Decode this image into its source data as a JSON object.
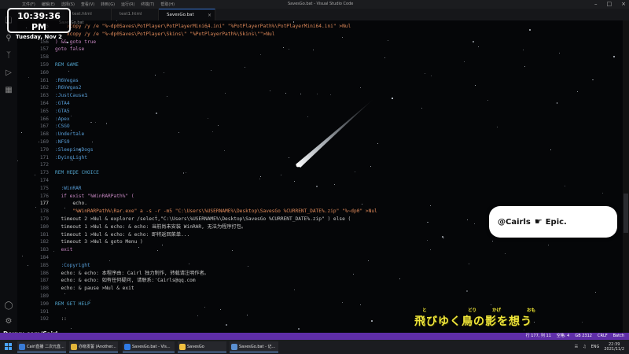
{
  "window": {
    "title": "SavesGo.bat - Visual Studio Code",
    "menu": [
      "文件(F)",
      "编辑(E)",
      "选择(S)",
      "查看(V)",
      "转到(G)",
      "运行(R)",
      "终端(T)",
      "帮助(H)"
    ]
  },
  "tabs": [
    {
      "label": "test.html",
      "active": false
    },
    {
      "label": "test1.html",
      "active": false
    },
    {
      "label": "SavesGo.bat",
      "active": true
    }
  ],
  "breadcrumb": "SavesGo.bat",
  "editor": {
    "lines": [
      {
        "n": "155",
        "code": "    xcopy /y /e \"%~dp0Saves\\PotPlayer\\PotPlayerMini64.ini\" \"%PotPlayerPath%\\PotPlayerMini64.ini\" >Nul",
        "cls": "str"
      },
      {
        "n": "",
        "code": "    xcopy /y /e \"%~dp0Saves\\PotPlayer\\Skins\\\" \"%PotPlayerPath%\\Skins\\\"\">Nul",
        "cls": "str"
      },
      {
        "n": "156",
        "code": ") && goto true",
        "cls": "kw"
      },
      {
        "n": "157",
        "code": "goto false",
        "cls": "kw"
      },
      {
        "n": "158",
        "code": "",
        "cls": ""
      },
      {
        "n": "159",
        "code": "REM GAME",
        "cls": "cm"
      },
      {
        "n": "160",
        "code": "",
        "cls": ""
      },
      {
        "n": "161",
        "code": ":R6Vegas",
        "cls": "lbl"
      },
      {
        "n": "162",
        "code": ":R6Vegas2",
        "cls": "lbl"
      },
      {
        "n": "163",
        "code": ":JustCause3",
        "cls": "lbl"
      },
      {
        "n": "164",
        "code": ":GTA4",
        "cls": "lbl"
      },
      {
        "n": "165",
        "code": ":GTA5",
        "cls": "lbl"
      },
      {
        "n": "166",
        "code": ":Apex",
        "cls": "lbl"
      },
      {
        "n": "167",
        "code": ":CSGO",
        "cls": "lbl"
      },
      {
        "n": "168",
        "code": ":Undertale",
        "cls": "lbl"
      },
      {
        "n": "169",
        "code": ":NFS9",
        "cls": "lbl"
      },
      {
        "n": "170",
        "code": ":SleepingDogs",
        "cls": "lbl"
      },
      {
        "n": "171",
        "code": ":DyingLight",
        "cls": "lbl"
      },
      {
        "n": "172",
        "code": "",
        "cls": ""
      },
      {
        "n": "173",
        "code": "REM HEDE CHOICE",
        "cls": "cm"
      },
      {
        "n": "174",
        "code": "",
        "cls": ""
      },
      {
        "n": "175",
        "code": "  :WinRAR",
        "cls": "lbl"
      },
      {
        "n": "176",
        "code": "  if exist \"%WinRARPath%\" (",
        "cls": "kw"
      },
      {
        "n": "177",
        "code": "      echo.",
        "cls": "",
        "current": true
      },
      {
        "n": "178",
        "code": "      \"%WinRARPath%\\Rar.exe\" a -s -r -m5 \"C:\\Users\\%USERNAME%\\Desktop\\SavesGo %CURRENT_DATE%.zip\" \"%~dp0\" >Nul",
        "cls": "str"
      },
      {
        "n": "179",
        "code": "  timeout 2 >Nul & explorer /select,\"C:\\Users\\%USERNAME%\\Desktop\\SavesGo %CURRENT_DATE%.zip\" ) else (",
        "cls": ""
      },
      {
        "n": "180",
        "code": "  timeout 1 >Nul & echo: & echo: 当前尚未安装 WinRAR, 无法为程序打包。",
        "cls": ""
      },
      {
        "n": "181",
        "code": "  timeout 1 >Nul & echo: & echo: 即将返回菜单...",
        "cls": ""
      },
      {
        "n": "182",
        "code": "  timeout 3 >Nul & goto Menu )",
        "cls": ""
      },
      {
        "n": "183",
        "code": "  exit",
        "cls": "kw"
      },
      {
        "n": "184",
        "code": "",
        "cls": ""
      },
      {
        "n": "185",
        "code": "  :Copyright",
        "cls": "lbl"
      },
      {
        "n": "186",
        "code": "  echo: & echo: 本程序由: Cairl 独力制作, 转载请注明作者。",
        "cls": ""
      },
      {
        "n": "187",
        "code": "  echo: & echo: 如有任何疑问, 请联系: Cairls@qq.com",
        "cls": ""
      },
      {
        "n": "188",
        "code": "  echo: & pause >Nul & exit",
        "cls": ""
      },
      {
        "n": "189",
        "code": "",
        "cls": ""
      },
      {
        "n": "190",
        "code": "REM GET HELP",
        "cls": "cm"
      },
      {
        "n": "191",
        "code": "",
        "cls": ""
      },
      {
        "n": "192",
        "code": "  ::",
        "cls": ""
      }
    ]
  },
  "overlay": {
    "clock_time": "10:39:36 PM",
    "clock_date": "Tuesday, Nov 2",
    "bubble_user": "@Cairls",
    "bubble_text": "Epic.",
    "bubble_icon": "pointing-hand-icon",
    "watermark": "Douyu.com/Cairl",
    "lyrics": "飛びゆく鳥の影を想う",
    "lyrics_ruby": [
      "と",
      "とり",
      "かげ",
      "おも"
    ]
  },
  "statusbar": {
    "items": [
      "行 177, 列 11",
      "空格: 4",
      "GB 2312",
      "CRLF",
      "Batch"
    ]
  },
  "taskbar": {
    "items": [
      {
        "label": "Cairl直播 二次元直...",
        "color": "#3a7bd5"
      },
      {
        "label": "亦晓发誓 (Another...",
        "color": "#e0b43a"
      },
      {
        "label": "SavesGo.bat - Vis...",
        "color": "#2f7ae5"
      },
      {
        "label": "SavesGo",
        "color": "#f0c040"
      },
      {
        "label": "SavesGo.bat - 记...",
        "color": "#5a8fd0"
      }
    ],
    "tray_lang": "ENG",
    "tray_time": "22:39",
    "tray_date": "2021/11/2"
  },
  "colors": {
    "statusbar": "#5f2ea8",
    "lyrics": "#f0e63a",
    "accent": "#3a78d8"
  }
}
